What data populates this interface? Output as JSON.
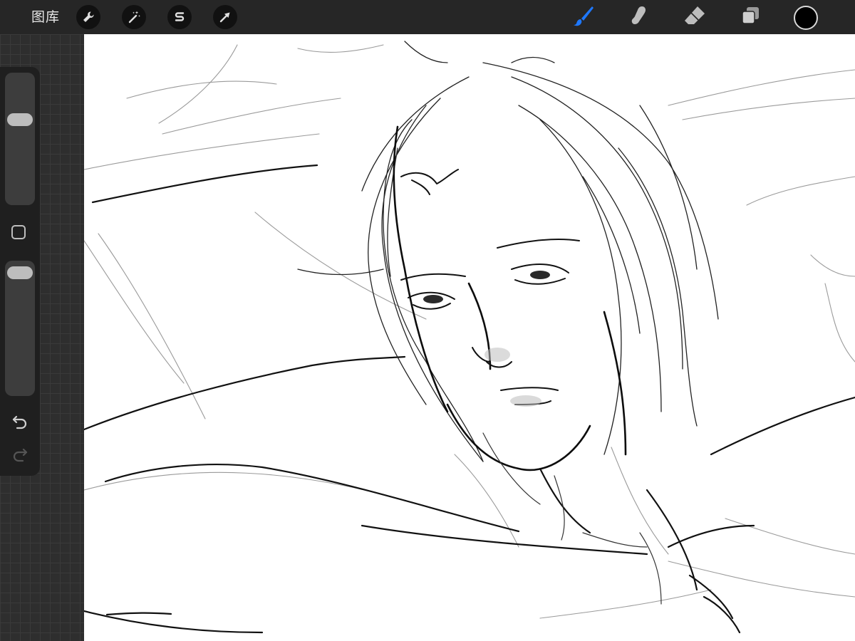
{
  "topbar": {
    "gallery_label": "图库",
    "left_tools": [
      {
        "name": "actions",
        "icon": "wrench-icon"
      },
      {
        "name": "adjustments",
        "icon": "magic-wand-icon"
      },
      {
        "name": "selection",
        "icon": "selection-s-icon"
      },
      {
        "name": "transform",
        "icon": "arrow-cursor-icon"
      }
    ],
    "right_tools": [
      {
        "name": "brush",
        "icon": "brush-icon",
        "active": true
      },
      {
        "name": "smudge",
        "icon": "smudge-finger-icon",
        "active": false
      },
      {
        "name": "eraser",
        "icon": "eraser-icon",
        "active": false
      },
      {
        "name": "layers",
        "icon": "layers-icon",
        "active": false
      }
    ],
    "current_color": "#000000"
  },
  "sidebar": {
    "brush_size": {
      "icon": "brush-size-slider",
      "level": 0.68
    },
    "modify": {
      "icon": "square-modify-icon"
    },
    "opacity": {
      "icon": "opacity-slider",
      "level": 1.0
    },
    "undo": {
      "icon": "undo-icon"
    },
    "redo": {
      "icon": "redo-icon",
      "enabled": false
    }
  },
  "colors": {
    "topbar_bg": "#262626",
    "active_tool": "#1e78ff",
    "inactive_tool": "#bdbdbd",
    "canvas": "#ffffff"
  }
}
